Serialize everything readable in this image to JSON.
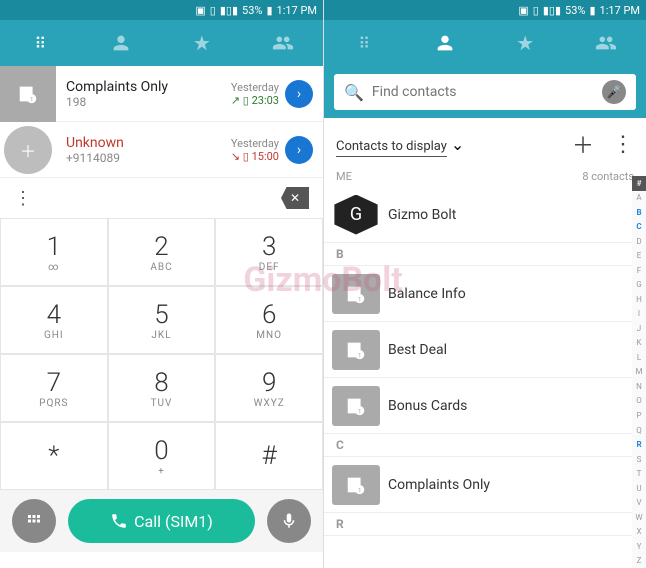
{
  "status": {
    "battery": "53%",
    "time": "1:17 PM"
  },
  "watermark": "GizmoBolt",
  "left": {
    "calls": [
      {
        "title": "Complaints Only",
        "sub": "198",
        "day": "Yesterday",
        "time": "23:03",
        "unknown": false,
        "dir": "in"
      },
      {
        "title": "Unknown",
        "sub": "+9114089",
        "day": "Yesterday",
        "time": "15:00",
        "unknown": true,
        "dir": "missed"
      }
    ],
    "keys": [
      {
        "n": "1",
        "l": "∞"
      },
      {
        "n": "2",
        "l": "ABC"
      },
      {
        "n": "3",
        "l": "DEF"
      },
      {
        "n": "4",
        "l": "GHI"
      },
      {
        "n": "5",
        "l": "JKL"
      },
      {
        "n": "6",
        "l": "MNO"
      },
      {
        "n": "7",
        "l": "PQRS"
      },
      {
        "n": "8",
        "l": "TUV"
      },
      {
        "n": "9",
        "l": "WXYZ"
      },
      {
        "n": "*",
        "l": ""
      },
      {
        "n": "0",
        "l": "+"
      },
      {
        "n": "#",
        "l": ""
      }
    ],
    "call_label": "Call (SIM1)"
  },
  "right": {
    "search_placeholder": "Find contacts",
    "filter_label": "Contacts to display",
    "me_label": "ME",
    "count_label": "8 contacts",
    "me_name": "Gizmo Bolt",
    "groups": [
      {
        "letter": "B",
        "items": [
          "Balance Info",
          "Best Deal",
          "Bonus Cards"
        ]
      },
      {
        "letter": "C",
        "items": [
          "Complaints Only"
        ]
      },
      {
        "letter": "R",
        "items": []
      }
    ],
    "index": [
      "#",
      "A",
      "B",
      "C",
      "D",
      "E",
      "F",
      "G",
      "H",
      "I",
      "J",
      "K",
      "L",
      "M",
      "N",
      "O",
      "P",
      "Q",
      "R",
      "S",
      "T",
      "U",
      "V",
      "W",
      "X",
      "Y",
      "Z"
    ],
    "index_hl": [
      "B",
      "C",
      "R"
    ]
  }
}
